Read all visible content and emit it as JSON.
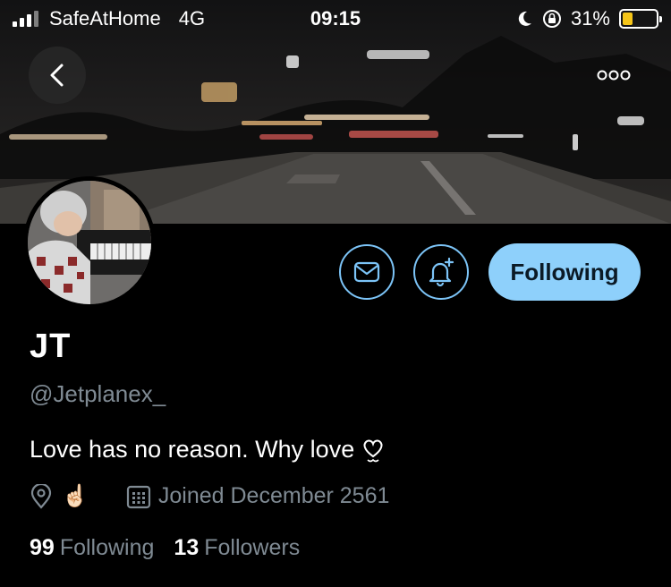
{
  "status_bar": {
    "carrier": "SafeAtHome",
    "network": "4G",
    "time": "09:15",
    "battery": "31%",
    "battery_level": 0.31
  },
  "profile": {
    "display_name": "JT",
    "handle": "@Jetplanex_",
    "bio": "Love has no reason. Why love",
    "location_emoji": "☝🏻",
    "joined": "Joined December 2561",
    "following_count": "99",
    "following_label": "Following",
    "followers_count": "13",
    "followers_label": "Followers"
  },
  "actions": {
    "following_button_label": "Following"
  },
  "colors": {
    "accent": "#8ed0fb",
    "outline": "#7cc4f7",
    "secondary_text": "#7f8a93",
    "battery_fill": "#f5c518"
  },
  "icons": {
    "back": "chevron-left-icon",
    "more": "more-horizontal-icon",
    "message": "mail-icon",
    "notify": "bell-plus-icon",
    "location": "location-pin-icon",
    "calendar": "calendar-icon",
    "bio_heart": "heart-icon"
  }
}
